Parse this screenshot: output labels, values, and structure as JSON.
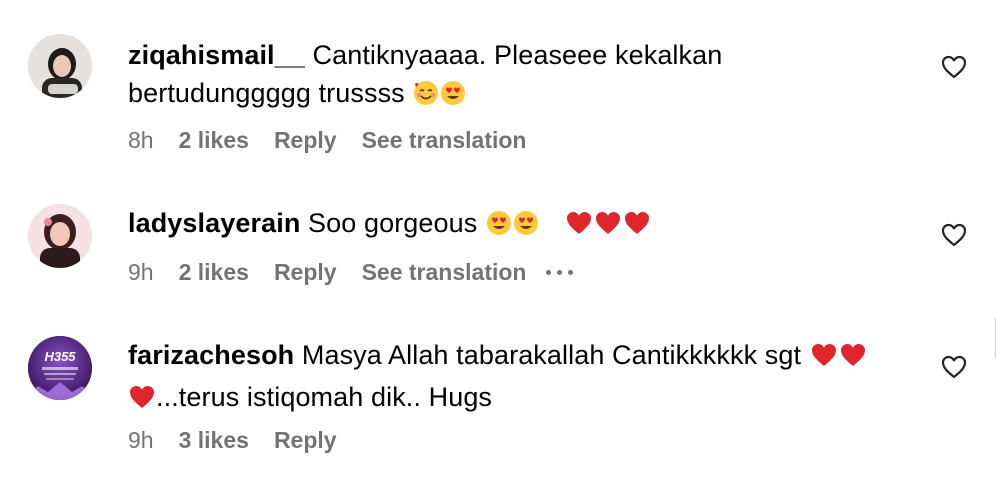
{
  "comments": [
    {
      "username": "ziqahismail__",
      "text_line1": "Cantiknyaaaa. Pleaseee kekalkan",
      "text_line2": "bertudunggggg trussss",
      "time": "8h",
      "likes": "2 likes",
      "reply": "Reply",
      "translate": "See translation",
      "emojis": [
        "smiling-face-with-hearts",
        "heart-eyes"
      ],
      "avatar_color": "#d9d4cf"
    },
    {
      "username": "ladyslayerain",
      "text": "Soo gorgeous",
      "time": "9h",
      "likes": "2 likes",
      "reply": "Reply",
      "translate": "See translation",
      "emojis": [
        "heart-eyes",
        "heart-eyes",
        "red-heart",
        "red-heart",
        "red-heart"
      ],
      "avatar_color": "#f3d5d6"
    },
    {
      "username": "farizachesoh",
      "text_line1": "Masya Allah tabarakallah Cantikkkkkk sgt",
      "text_line2": "...terus istiqomah dik.. Hugs",
      "time": "9h",
      "likes": "3 likes",
      "reply": "Reply",
      "emojis": [
        "red-heart",
        "red-heart",
        "red-heart"
      ],
      "avatar_text": "H355",
      "avatar_color": "#5b2a8a"
    }
  ],
  "colors": {
    "meta_gray": "#737373",
    "heart_red": "#e0262d",
    "emoji_yellow": "#ffc93b"
  }
}
